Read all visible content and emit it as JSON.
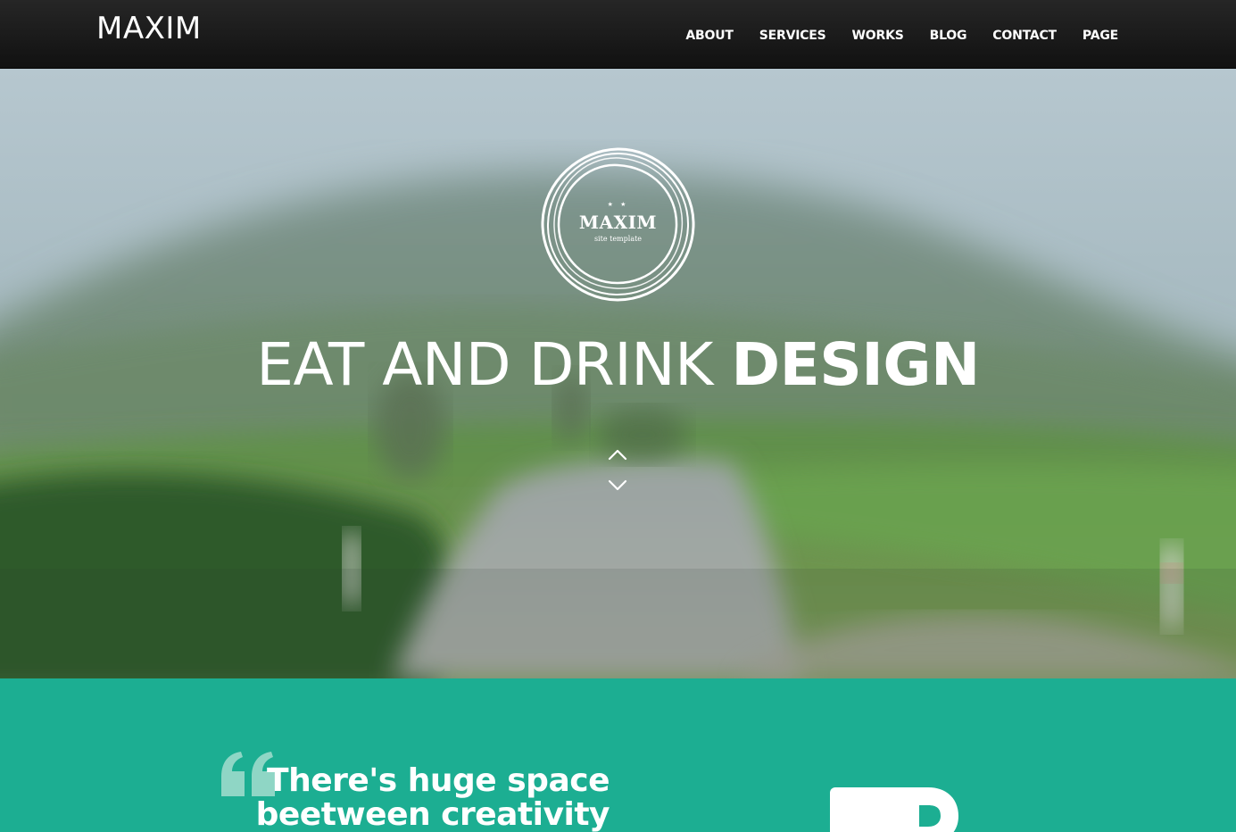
{
  "header": {
    "brand": "MAXIM",
    "nav": [
      "ABOUT",
      "SERVICES",
      "WORKS",
      "BLOG",
      "CONTACT",
      "PAGE"
    ]
  },
  "hero": {
    "badge_title": "MAXIM",
    "badge_subtitle": "site template",
    "badge_stars": "★ ★",
    "headline_light": "EAT AND DRINK",
    "headline_bold": "DESIGN"
  },
  "quote": {
    "line1": "There's huge space",
    "line2": "beetween creativity and"
  },
  "colors": {
    "accent": "#1cae92",
    "header": "#1a1a1a",
    "quote_mark": "#8fd6c5"
  },
  "icons": [
    "quote-icon",
    "chevron-up-icon",
    "chevron-down-icon",
    "mug-icon"
  ]
}
